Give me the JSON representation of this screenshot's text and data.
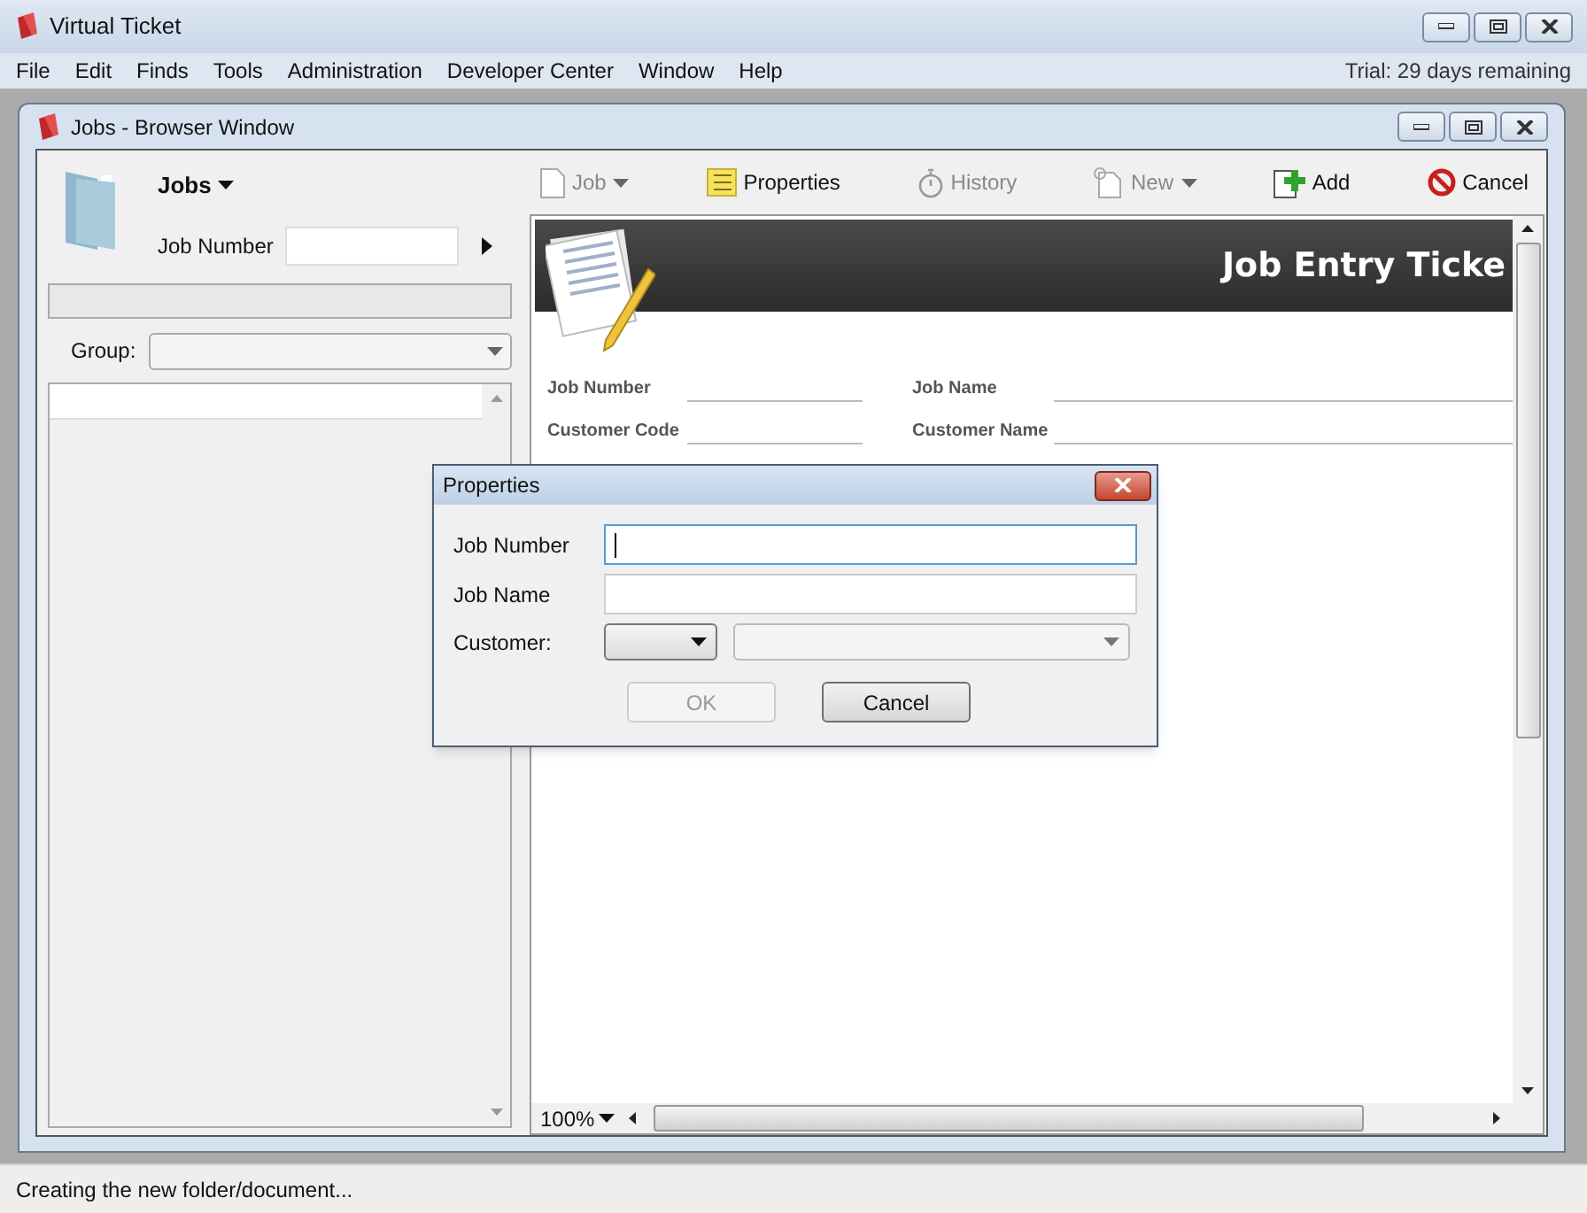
{
  "app": {
    "title": "Virtual Ticket",
    "menu": [
      "File",
      "Edit",
      "Finds",
      "Tools",
      "Administration",
      "Developer Center",
      "Window",
      "Help"
    ],
    "trial": "Trial: 29 days remaining"
  },
  "browser": {
    "title": "Jobs - Browser Window",
    "folder_label": "Jobs",
    "job_number_label": "Job Number",
    "group_label": "Group:",
    "toolbar": [
      {
        "label": "Job",
        "kind": "document",
        "disabled": true,
        "dropdown": true
      },
      {
        "label": "Properties",
        "kind": "notes",
        "disabled": false,
        "dropdown": false
      },
      {
        "label": "History",
        "kind": "stopwatch",
        "disabled": true,
        "dropdown": false
      },
      {
        "label": "New",
        "kind": "new",
        "disabled": true,
        "dropdown": true
      },
      {
        "label": "Add",
        "kind": "add",
        "disabled": false,
        "dropdown": false
      },
      {
        "label": "Cancel",
        "kind": "cancel",
        "disabled": false,
        "dropdown": false
      }
    ],
    "ticket": {
      "title": "Job Entry Ticke",
      "fields": [
        {
          "left": "Job Number",
          "right": "Job Name"
        },
        {
          "left": "Customer Code",
          "right": "Customer Name"
        }
      ]
    },
    "zoom": "100%"
  },
  "dialog": {
    "title": "Properties",
    "fields": [
      {
        "label": "Job Number",
        "focused": true
      },
      {
        "label": "Job Name",
        "focused": false
      }
    ],
    "customer_label": "Customer:",
    "buttons": [
      {
        "label": "OK",
        "disabled": true
      },
      {
        "label": "Cancel",
        "disabled": false
      }
    ]
  },
  "status_bar": "Creating the new folder/document..."
}
